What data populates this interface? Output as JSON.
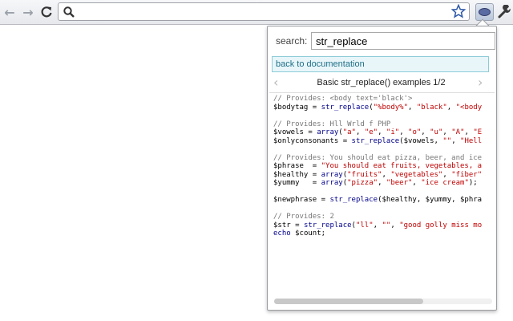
{
  "browser": {
    "omnibox_value": "",
    "icons": [
      "back-arrow-icon",
      "forward-arrow-icon",
      "reload-icon",
      "search-icon",
      "star-icon",
      "php-extension-icon",
      "wrench-icon"
    ]
  },
  "popup": {
    "search_label": "search:",
    "search_value": "str_replace",
    "back_link": "back to documentation",
    "example_title": "Basic str_replace() examples 1/2",
    "code_lines": [
      [
        {
          "t": "// Provides: <body text='black'>",
          "c": "comment"
        }
      ],
      [
        {
          "t": "$bodytag = ",
          "c": "var"
        },
        {
          "t": "str_replace",
          "c": "fn"
        },
        {
          "t": "(",
          "c": "var"
        },
        {
          "t": "\"%body%\"",
          "c": "str"
        },
        {
          "t": ", ",
          "c": "var"
        },
        {
          "t": "\"black\"",
          "c": "str"
        },
        {
          "t": ", ",
          "c": "var"
        },
        {
          "t": "\"<body",
          "c": "str"
        }
      ],
      [
        {
          "t": "",
          "c": "var"
        }
      ],
      [
        {
          "t": "// Provides: Hll Wrld f PHP",
          "c": "comment"
        }
      ],
      [
        {
          "t": "$vowels = ",
          "c": "var"
        },
        {
          "t": "array",
          "c": "fn"
        },
        {
          "t": "(",
          "c": "var"
        },
        {
          "t": "\"a\"",
          "c": "str"
        },
        {
          "t": ", ",
          "c": "var"
        },
        {
          "t": "\"e\"",
          "c": "str"
        },
        {
          "t": ", ",
          "c": "var"
        },
        {
          "t": "\"i\"",
          "c": "str"
        },
        {
          "t": ", ",
          "c": "var"
        },
        {
          "t": "\"o\"",
          "c": "str"
        },
        {
          "t": ", ",
          "c": "var"
        },
        {
          "t": "\"u\"",
          "c": "str"
        },
        {
          "t": ", ",
          "c": "var"
        },
        {
          "t": "\"A\"",
          "c": "str"
        },
        {
          "t": ", ",
          "c": "var"
        },
        {
          "t": "\"E",
          "c": "str"
        }
      ],
      [
        {
          "t": "$onlyconsonants = ",
          "c": "var"
        },
        {
          "t": "str_replace",
          "c": "fn"
        },
        {
          "t": "($vowels, ",
          "c": "var"
        },
        {
          "t": "\"\"",
          "c": "str"
        },
        {
          "t": ", ",
          "c": "var"
        },
        {
          "t": "\"Hell",
          "c": "str"
        }
      ],
      [
        {
          "t": "",
          "c": "var"
        }
      ],
      [
        {
          "t": "// Provides: You should eat pizza, beer, and ice",
          "c": "comment"
        }
      ],
      [
        {
          "t": "$phrase  = ",
          "c": "var"
        },
        {
          "t": "\"You should eat fruits, vegetables, a",
          "c": "str"
        }
      ],
      [
        {
          "t": "$healthy = ",
          "c": "var"
        },
        {
          "t": "array",
          "c": "fn"
        },
        {
          "t": "(",
          "c": "var"
        },
        {
          "t": "\"fruits\"",
          "c": "str"
        },
        {
          "t": ", ",
          "c": "var"
        },
        {
          "t": "\"vegetables\"",
          "c": "str"
        },
        {
          "t": ", ",
          "c": "var"
        },
        {
          "t": "\"fiber\"",
          "c": "str"
        }
      ],
      [
        {
          "t": "$yummy   = ",
          "c": "var"
        },
        {
          "t": "array",
          "c": "fn"
        },
        {
          "t": "(",
          "c": "var"
        },
        {
          "t": "\"pizza\"",
          "c": "str"
        },
        {
          "t": ", ",
          "c": "var"
        },
        {
          "t": "\"beer\"",
          "c": "str"
        },
        {
          "t": ", ",
          "c": "var"
        },
        {
          "t": "\"ice cream\"",
          "c": "str"
        },
        {
          "t": ");",
          "c": "var"
        }
      ],
      [
        {
          "t": "",
          "c": "var"
        }
      ],
      [
        {
          "t": "$newphrase = ",
          "c": "var"
        },
        {
          "t": "str_replace",
          "c": "fn"
        },
        {
          "t": "($healthy, $yummy, $phra",
          "c": "var"
        }
      ],
      [
        {
          "t": "",
          "c": "var"
        }
      ],
      [
        {
          "t": "// Provides: 2",
          "c": "comment"
        }
      ],
      [
        {
          "t": "$str = ",
          "c": "var"
        },
        {
          "t": "str_replace",
          "c": "fn"
        },
        {
          "t": "(",
          "c": "var"
        },
        {
          "t": "\"ll\"",
          "c": "str"
        },
        {
          "t": ", ",
          "c": "var"
        },
        {
          "t": "\"\"",
          "c": "str"
        },
        {
          "t": ", ",
          "c": "var"
        },
        {
          "t": "\"good golly miss mo",
          "c": "str"
        }
      ],
      [
        {
          "t": "echo",
          "c": "kw"
        },
        {
          "t": " $count;",
          "c": "var"
        }
      ]
    ]
  }
}
